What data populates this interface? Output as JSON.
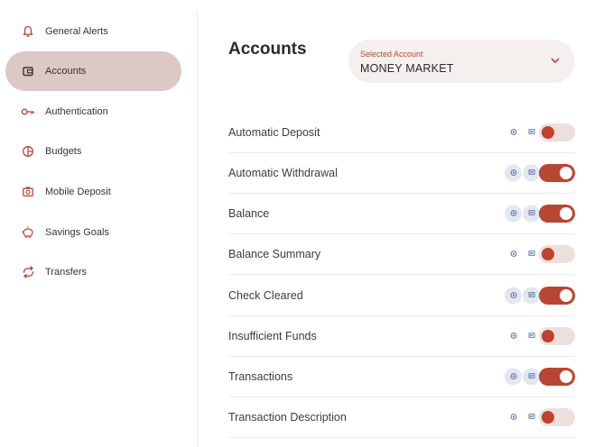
{
  "sidebar": {
    "items": [
      {
        "label": "General Alerts",
        "icon": "bell-icon",
        "active": false
      },
      {
        "label": "Accounts",
        "icon": "wallet-icon",
        "active": true
      },
      {
        "label": "Authentication",
        "icon": "key-icon",
        "active": false
      },
      {
        "label": "Budgets",
        "icon": "pie-chart-icon",
        "active": false
      },
      {
        "label": "Mobile Deposit",
        "icon": "camera-icon",
        "active": false
      },
      {
        "label": "Savings Goals",
        "icon": "piggy-bank-icon",
        "active": false
      },
      {
        "label": "Transfers",
        "icon": "transfer-arrows-icon",
        "active": false
      }
    ]
  },
  "main": {
    "title": "Accounts",
    "account_select": {
      "label": "Selected Account",
      "value": "MONEY MARKET"
    },
    "rows": [
      {
        "label": "Automatic Deposit",
        "enabled": false
      },
      {
        "label": "Automatic Withdrawal",
        "enabled": true
      },
      {
        "label": "Balance",
        "enabled": true
      },
      {
        "label": "Balance Summary",
        "enabled": false
      },
      {
        "label": "Check Cleared",
        "enabled": true
      },
      {
        "label": "Insufficient Funds",
        "enabled": false
      },
      {
        "label": "Transactions",
        "enabled": true
      },
      {
        "label": "Transaction Description",
        "enabled": false
      }
    ],
    "channels": [
      "email-icon",
      "message-icon",
      "phone-icon"
    ]
  },
  "colors": {
    "accent": "#b84632",
    "active_nav": "#dcc8c4",
    "toggle_off_track": "#ecdfdd",
    "channel_on_bg": "#e3e8ef"
  }
}
